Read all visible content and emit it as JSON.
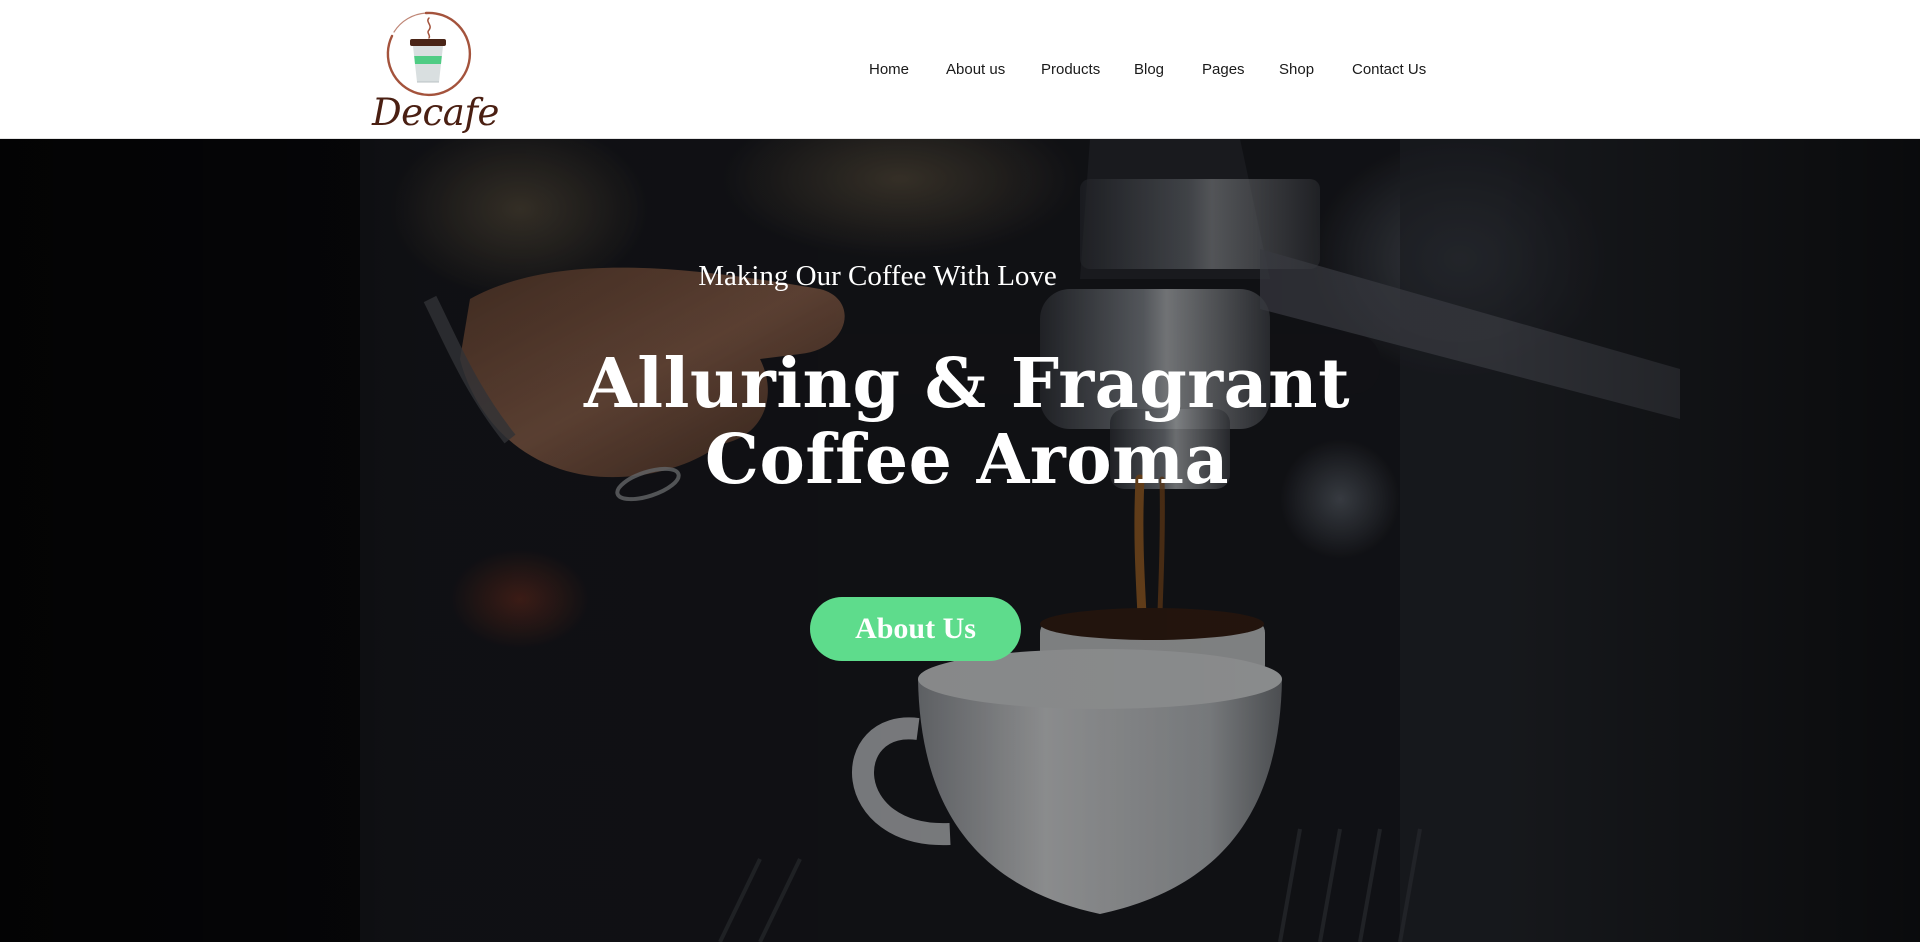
{
  "brand": {
    "name": "Decafe"
  },
  "nav": {
    "items": [
      {
        "label": "Home"
      },
      {
        "label": "About us"
      },
      {
        "label": "Products"
      },
      {
        "label": "Blog"
      },
      {
        "label": "Pages"
      },
      {
        "label": "Shop"
      },
      {
        "label": "Contact Us"
      }
    ]
  },
  "hero": {
    "tagline": "Making Our Coffee With Love",
    "headline_line1": "Alluring & Fragrant",
    "headline_line2": "Coffee Aroma",
    "cta_label": "About Us"
  },
  "colors": {
    "accent": "#5edc8c",
    "brand_text": "#4a1f12",
    "logo_ring": "#a4533c",
    "nav_text": "#1a1a1a"
  }
}
